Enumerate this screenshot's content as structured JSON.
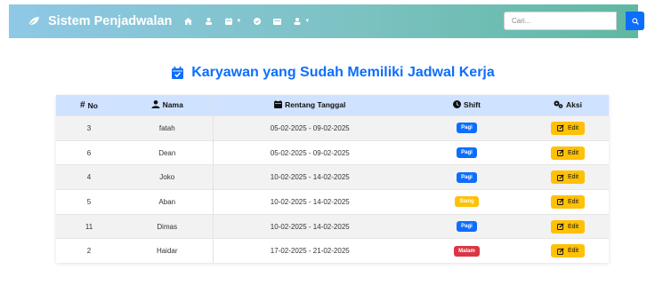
{
  "navbar": {
    "brand": "Sistem Penjadwalan",
    "search_placeholder": "Cari...",
    "nav_icons": [
      "home-icon",
      "users-icon",
      "calendar-icon",
      "check-circle-icon",
      "table-icon",
      "user-icon"
    ]
  },
  "heading": {
    "title": "Karyawan yang Sudah Memiliki Jadwal Kerja"
  },
  "table": {
    "headers": {
      "no": "No",
      "nama": "Nama",
      "rentang": "Rentang Tanggal",
      "shift": "Shift",
      "aksi": "Aksi"
    },
    "edit_label": "Edit",
    "rows": [
      {
        "no": "3",
        "nama": "fatah",
        "rentang": "05-02-2025 - 09-02-2025",
        "shift": "Pagi",
        "shift_color": "#0d6efd"
      },
      {
        "no": "6",
        "nama": "Dean",
        "rentang": "05-02-2025 - 09-02-2025",
        "shift": "Pagi",
        "shift_color": "#0d6efd"
      },
      {
        "no": "4",
        "nama": "Joko",
        "rentang": "10-02-2025 - 14-02-2025",
        "shift": "Pagi",
        "shift_color": "#0d6efd"
      },
      {
        "no": "5",
        "nama": "Aban",
        "rentang": "10-02-2025 - 14-02-2025",
        "shift": "Siang",
        "shift_color": "#ffc107"
      },
      {
        "no": "11",
        "nama": "Dimas",
        "rentang": "10-02-2025 - 14-02-2025",
        "shift": "Pagi",
        "shift_color": "#0d6efd"
      },
      {
        "no": "2",
        "nama": "Haidar",
        "rentang": "17-02-2025 - 21-02-2025",
        "shift": "Malam",
        "shift_color": "#dc3545"
      }
    ]
  },
  "colors": {
    "accent": "#0d6efd",
    "header_bg": "#cfe2ff",
    "edit_button": "#ffc107"
  }
}
